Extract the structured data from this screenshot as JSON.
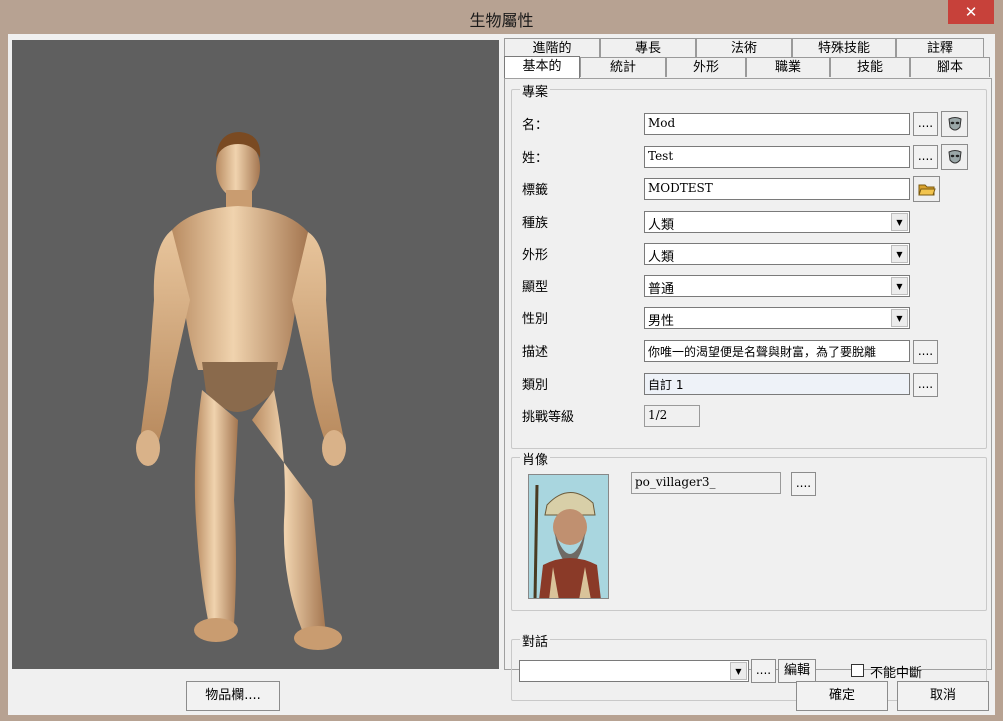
{
  "window": {
    "title": "生物屬性",
    "close_glyph": "✕"
  },
  "tabs": {
    "back_row": [
      "進階的",
      "專長",
      "法術",
      "特殊技能",
      "註釋"
    ],
    "front_row": [
      "基本的",
      "統計",
      "外形",
      "職業",
      "技能",
      "腳本"
    ],
    "active": "基本的"
  },
  "profile": {
    "group_label": "專案",
    "first_name_label": "名：",
    "first_name_value": "Mod",
    "last_name_label": "姓：",
    "last_name_value": "Test",
    "tag_label": "標籤",
    "tag_value": "MODTEST",
    "race_label": "種族",
    "race_value": "人類",
    "appearance_label": "外形",
    "appearance_value": "人類",
    "type_label": "顯型",
    "type_value": "普通",
    "gender_label": "性別",
    "gender_value": "男性",
    "description_label": "描述",
    "description_value": "你唯一的渴望便是名聲與財富，為了要脫離",
    "category_label": "類別",
    "category_value": "自訂 1",
    "cr_label": "挑戰等級",
    "cr_value": "1/2",
    "ellipsis": "...."
  },
  "portrait": {
    "group_label": "肖像",
    "resref": "po_villager3_",
    "ellipsis": "...."
  },
  "conversation": {
    "group_label": "對話",
    "value": "",
    "ellipsis": "....",
    "edit_label": "編輯",
    "no_interrupt_label": "不能中斷",
    "no_interrupt_checked": false
  },
  "footer": {
    "inventory_label": "物品欄....",
    "ok_label": "確定",
    "cancel_label": "取消"
  },
  "icons": {
    "mask": "face-mask-icon",
    "folder": "open-folder-icon",
    "dropdown": "chevron-down-icon"
  }
}
